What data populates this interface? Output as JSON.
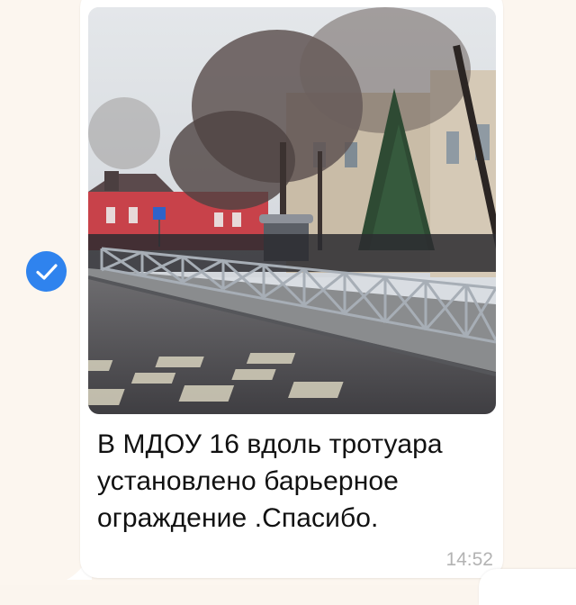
{
  "message": {
    "caption": "В МДОУ 16 вдоль тротуара\nустановлено барьерное\nограждение .Спасибо.",
    "time": "14:52",
    "selected": true,
    "photo_description_icon": "photo"
  },
  "colors": {
    "chat_background": "#fcf6ef",
    "bubble_background": "#ffffff",
    "check_accent": "#2f83ee",
    "timestamp": "#b3b3b3",
    "text": "#111111"
  },
  "icons": {
    "selection": "check-circle-icon"
  }
}
